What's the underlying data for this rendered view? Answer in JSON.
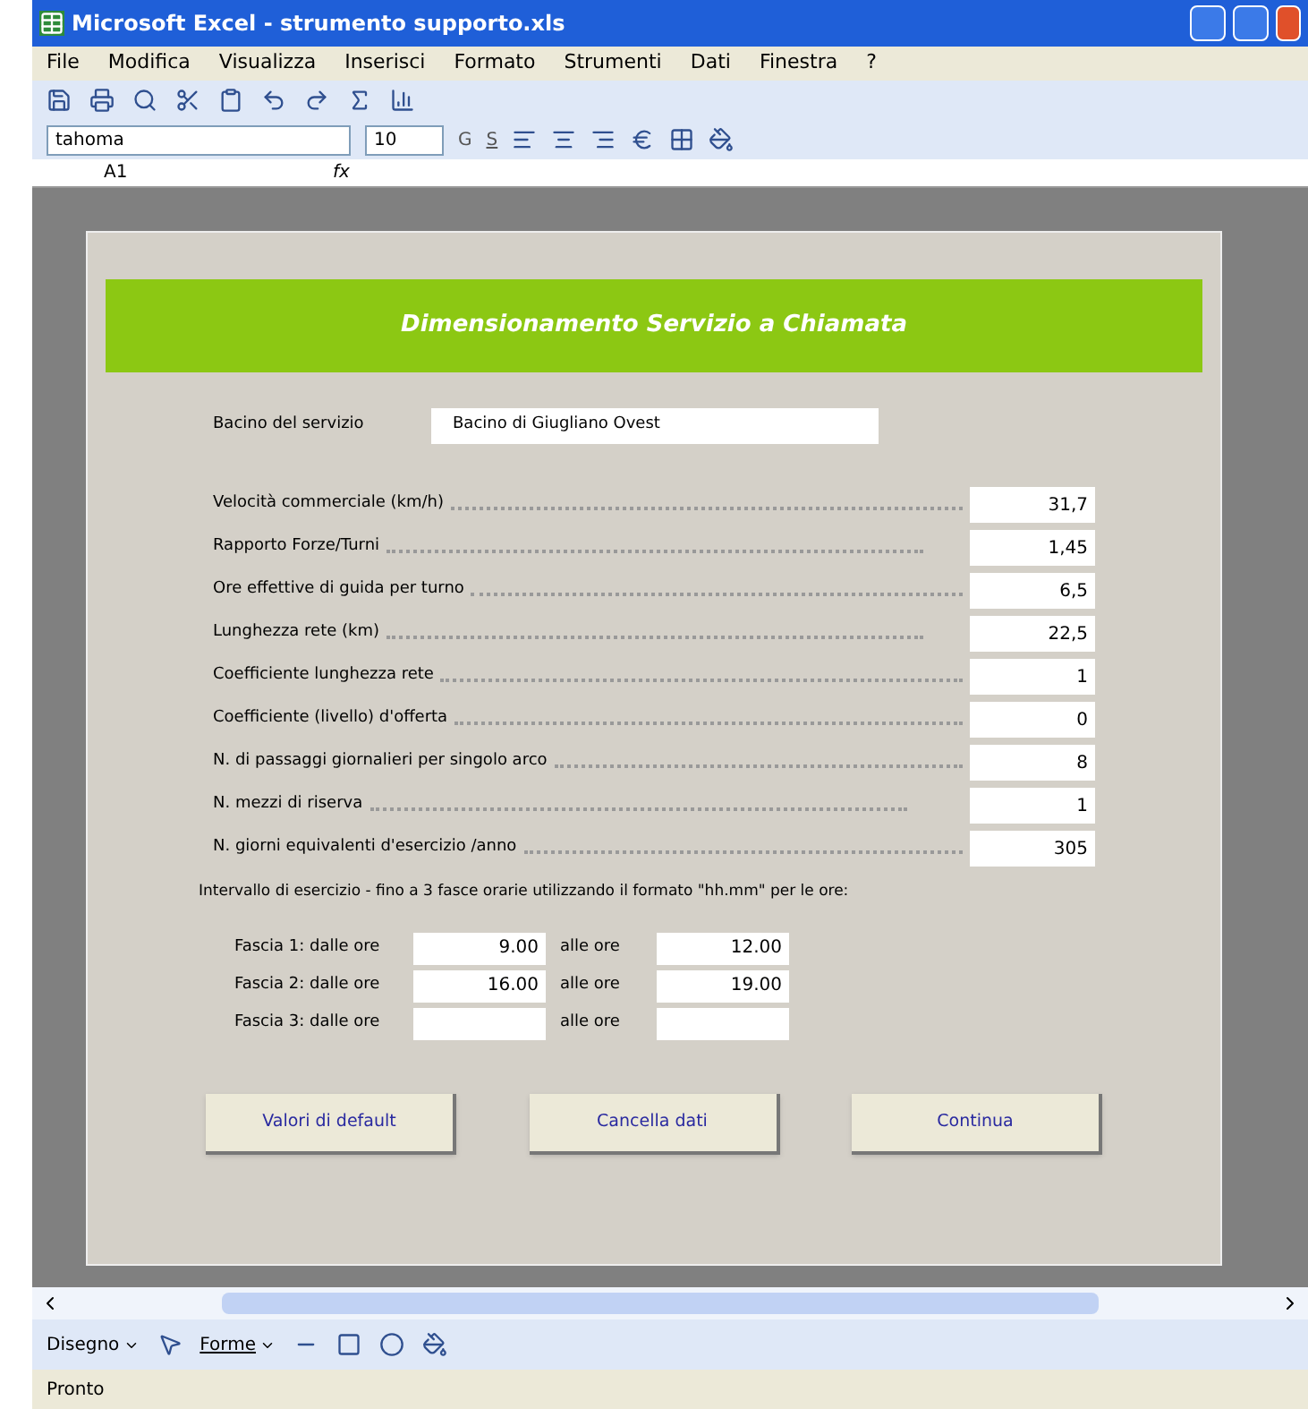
{
  "window": {
    "title": "Microsoft Excel - strumento supporto.xls"
  },
  "menu": [
    {
      "label": "File"
    },
    {
      "label": "Modifica"
    },
    {
      "label": "Visualizza"
    },
    {
      "label": "Inserisci"
    },
    {
      "label": "Formato"
    },
    {
      "label": "Strumenti"
    },
    {
      "label": "Dati"
    },
    {
      "label": "Finestra"
    },
    {
      "label": "?"
    }
  ],
  "format_toolbar": {
    "font": "tahoma",
    "size": "10",
    "bold": "G",
    "underline": "S"
  },
  "formula_bar": {
    "cell": "A1",
    "fx": "fx"
  },
  "form": {
    "title": "Dimensionamento Servizio a Chiamata",
    "basin": {
      "label": "Bacino del servizio",
      "value": "Bacino di Giugliano Ovest"
    },
    "fields": [
      {
        "label": "Velocità commerciale (km/h)",
        "value": "31,7"
      },
      {
        "label": "Rapporto Forze/Turni",
        "value": "1,45"
      },
      {
        "label": "Ore effettive di guida per turno",
        "value": "6,5"
      },
      {
        "label": "Lunghezza rete (km)",
        "value": "22,5"
      },
      {
        "label": "Coefficiente lunghezza rete",
        "value": "1"
      },
      {
        "label": "Coefficiente (livello) d'offerta",
        "value": "0"
      },
      {
        "label": "N. di passaggi giornalieri per singolo arco",
        "value": "8"
      },
      {
        "label": "N. mezzi di riserva",
        "value": "1"
      },
      {
        "label": "N. giorni equivalenti d'esercizio /anno",
        "value": "305"
      }
    ],
    "interval_note": "Intervallo di esercizio - fino a 3 fasce orarie utilizzando il formato \"hh.mm\" per le ore:",
    "bands": [
      {
        "label": "Fascia 1: dalle ore",
        "from": "9.00",
        "to_label": "alle ore",
        "to": "12.00"
      },
      {
        "label": "Fascia 2: dalle ore",
        "from": "16.00",
        "to_label": "alle ore",
        "to": "19.00"
      },
      {
        "label": "Fascia 3: dalle ore",
        "to_label": "alle ore"
      }
    ],
    "buttons": [
      "Valori di default",
      "Cancella dati",
      "Continua"
    ]
  },
  "drawing_toolbar": {
    "draw": "Disegno",
    "shapes": "Forme"
  },
  "status_bar": "Pronto"
}
